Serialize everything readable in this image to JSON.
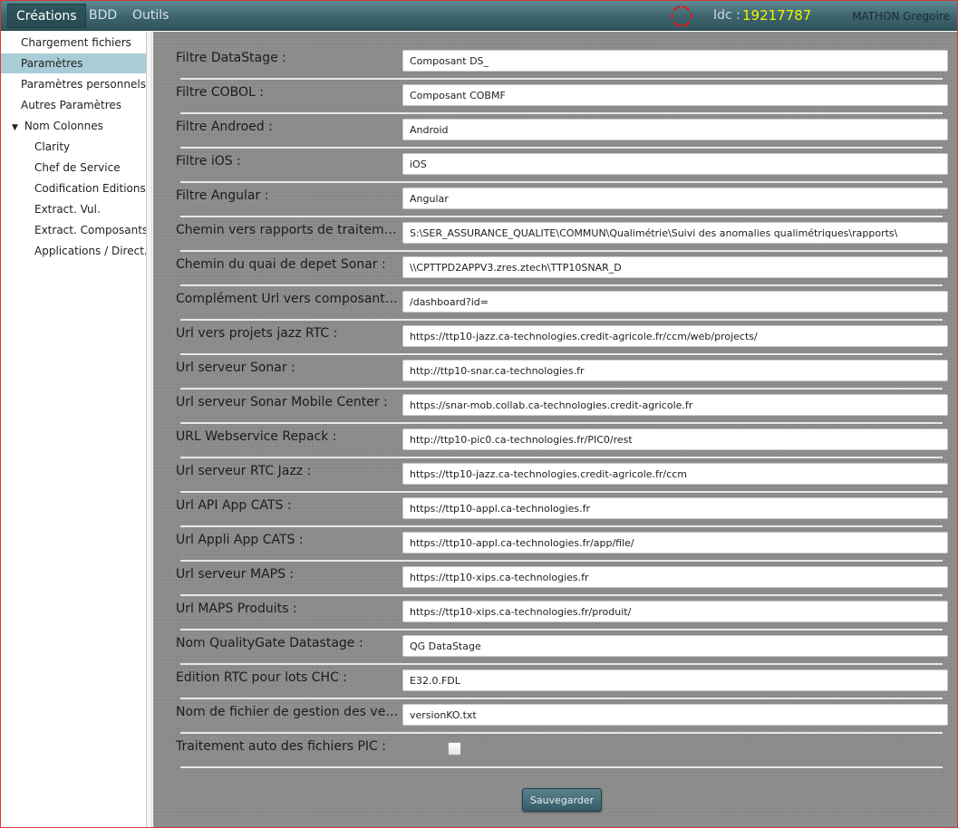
{
  "menubar": {
    "items": [
      {
        "label": "Créations",
        "active": true
      },
      {
        "label": "BDD",
        "active": false
      },
      {
        "label": "Outils",
        "active": false
      }
    ],
    "idc_label": "Idc :",
    "idc_value": "19217787",
    "user_name": "MATHON Gregoire"
  },
  "sidebar": {
    "items": [
      {
        "label": "Chargement fichiers",
        "level": 0,
        "selected": false
      },
      {
        "label": "Paramètres",
        "level": 0,
        "selected": true
      },
      {
        "label": "Paramètres personnels",
        "level": 0,
        "selected": false
      },
      {
        "label": "Autres Paramètres",
        "level": 0,
        "selected": false
      },
      {
        "label": "Nom Colonnes",
        "level": 0,
        "selected": false,
        "expanded": true
      },
      {
        "label": "Clarity",
        "level": 1,
        "selected": false
      },
      {
        "label": "Chef de Service",
        "level": 1,
        "selected": false
      },
      {
        "label": "Codification Editions",
        "level": 1,
        "selected": false
      },
      {
        "label": "Extract. Vul.",
        "level": 1,
        "selected": false
      },
      {
        "label": "Extract. Composants",
        "level": 1,
        "selected": false
      },
      {
        "label": "Applications / Direct...",
        "level": 1,
        "selected": false
      }
    ],
    "expand_arrow": "▼"
  },
  "form": {
    "rows": [
      {
        "label": "Filtre DataStage :",
        "value": "Composant DS_"
      },
      {
        "label": "Filtre COBOL :",
        "value": "Composant COBMF"
      },
      {
        "label": "Filtre Androed :",
        "value": "Android"
      },
      {
        "label": "Filtre iOS :",
        "value": "iOS"
      },
      {
        "label": "Filtre Angular :",
        "value": "Angular"
      },
      {
        "label": "Chemin vers rapports de traitement :",
        "value": "S:\\SER_ASSURANCE_QUALITE\\COMMUN\\Qualimétrie\\Suivi des anomalies qualimétriques\\rapports\\"
      },
      {
        "label": "Chemin du quai de depet Sonar :",
        "value": "\\\\CPTTPD2APPV3.zres.ztech\\TTP10SNAR_D"
      },
      {
        "label": "Complément Url vers composants RT...",
        "value": "/dashboard?id="
      },
      {
        "label": "Url vers projets jazz RTC :",
        "value": "https://ttp10-jazz.ca-technologies.credit-agricole.fr/ccm/web/projects/"
      },
      {
        "label": "Url serveur Sonar :",
        "value": "http://ttp10-snar.ca-technologies.fr"
      },
      {
        "label": "Url serveur Sonar Mobile Center :",
        "value": "https://snar-mob.collab.ca-technologies.credit-agricole.fr"
      },
      {
        "label": "URL Webservice Repack :",
        "value": "http://ttp10-pic0.ca-technologies.fr/PIC0/rest"
      },
      {
        "label": "Url serveur RTC Jazz :",
        "value": "https://ttp10-jazz.ca-technologies.credit-agricole.fr/ccm"
      },
      {
        "label": "Url API App CATS :",
        "value": "https://ttp10-appl.ca-technologies.fr"
      },
      {
        "label": "Url Appli App CATS :",
        "value": "https://ttp10-appl.ca-technologies.fr/app/file/"
      },
      {
        "label": "Url serveur MAPS :",
        "value": "https://ttp10-xips.ca-technologies.fr"
      },
      {
        "label": "Url MAPS Produits :",
        "value": "https://ttp10-xips.ca-technologies.fr/produit/"
      },
      {
        "label": "Nom QualityGate Datastage :",
        "value": "QG DataStage"
      },
      {
        "label": "Edition RTC pour lots CHC :",
        "value": "E32.0.FDL"
      },
      {
        "label": "Nom de fichier de gestion des versi...",
        "value": "versionKO.txt"
      }
    ],
    "checkbox_row": {
      "label": "Traitement auto des fichiers PIC :",
      "checked": false
    },
    "save_label": "Sauvegarder"
  }
}
